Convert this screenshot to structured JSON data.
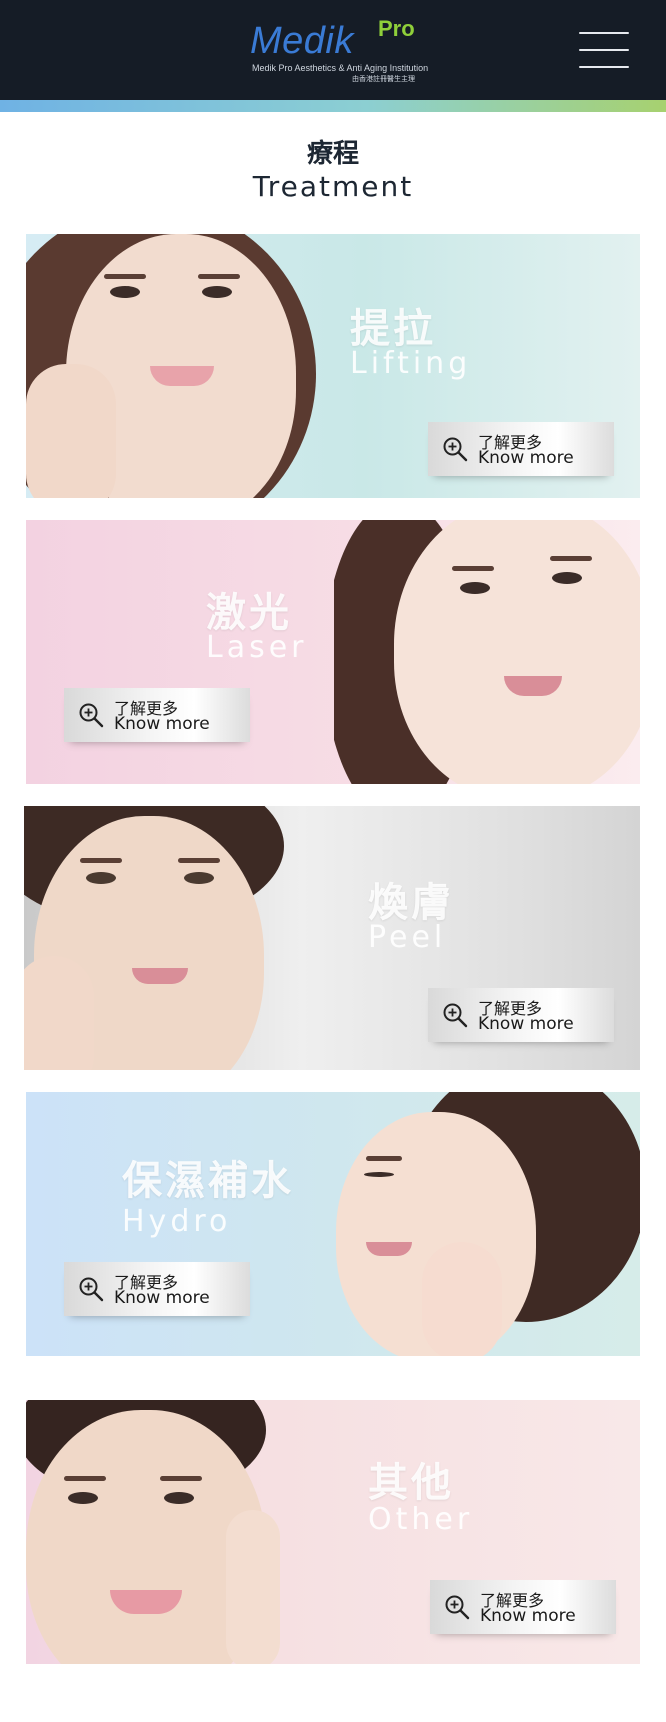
{
  "header": {
    "logo_main": "Medik",
    "logo_pro": "Pro",
    "logo_subtitle": "Medik Pro Aesthetics & Anti Aging Institution",
    "logo_subtitle_cn": "由香港註冊醫生主理",
    "menu_icon": "hamburger-menu-icon",
    "colors": {
      "bar": "#151c26",
      "logo_blue": "#3a7bd5",
      "logo_green": "#8fcf3a",
      "strip_start": "#6fb2e4",
      "strip_end": "#a7d16f"
    }
  },
  "section": {
    "title_cn": "療程",
    "title_en": "Treatment"
  },
  "cards": [
    {
      "title_cn": "提拉",
      "title_en": "Lifting",
      "button_cn": "了解更多",
      "button_en": "Know more",
      "icon": "zoom-in-icon",
      "background": "#cde8e8"
    },
    {
      "title_cn": "激光",
      "title_en": "Laser",
      "button_cn": "了解更多",
      "button_en": "Know more",
      "icon": "zoom-in-icon",
      "background": "#f4d9e2"
    },
    {
      "title_cn": "煥膚",
      "title_en": "Peel",
      "button_cn": "了解更多",
      "button_en": "Know more",
      "icon": "zoom-in-icon",
      "background": "#e2e2e2"
    },
    {
      "title_cn": "保濕補水",
      "title_en": "Hydro",
      "button_cn": "了解更多",
      "button_en": "Know more",
      "icon": "zoom-in-icon",
      "background": "#cfe6ee"
    },
    {
      "title_cn": "其他",
      "title_en": "Other",
      "button_cn": "了解更多",
      "button_en": "Know more",
      "icon": "zoom-in-icon",
      "background": "#f6e2e4"
    }
  ]
}
